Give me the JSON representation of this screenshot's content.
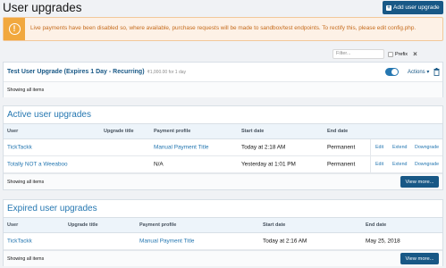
{
  "header": {
    "title": "User upgrades",
    "add_button": "Add user upgrade"
  },
  "notice": {
    "message": "Live payments have been disabled so, where available, purchase requests will be made to sandbox/test endpoints. To rectify this, please edit config.php."
  },
  "filter": {
    "placeholder": "Filter...",
    "prefix_label": "Prefix",
    "clear": "×"
  },
  "test_upgrade": {
    "title": "Test User Upgrade (Expires 1 Day - Recurring)",
    "price": "₹1,000.00 for 1 day",
    "toggle_on": true,
    "actions_label": "Actions ▾",
    "footer": "Showing all items"
  },
  "active": {
    "title": "Active user upgrades",
    "columns": {
      "user": "User",
      "upgrade": "Upgrade title",
      "payment": "Payment profile",
      "start": "Start date",
      "end": "End date"
    },
    "rows": [
      {
        "user": "TickTackk",
        "upgrade": "",
        "payment": "Manual Payment Title",
        "start": "Today at 2:18 AM",
        "end": "Permanent",
        "edit": "Edit",
        "extend": "Extend",
        "downgrade": "Downgrade"
      },
      {
        "user": "Totally NOT a Weeaboo",
        "upgrade": "",
        "payment": "N/A",
        "start": "Yesterday at 1:01 PM",
        "end": "Permanent",
        "edit": "Edit",
        "extend": "Extend",
        "downgrade": "Downgrade"
      }
    ],
    "footer": "Showing all items",
    "view_more": "View more..."
  },
  "expired": {
    "title": "Expired user upgrades",
    "columns": {
      "user": "User",
      "upgrade": "Upgrade title",
      "payment": "Payment profile",
      "start": "Start date",
      "end": "End date"
    },
    "rows": [
      {
        "user": "TickTackk",
        "upgrade": "",
        "payment": "Manual Payment Title",
        "start": "Today at 2:16 AM",
        "end": "May 25, 2018"
      }
    ],
    "footer": "Showing all items",
    "view_more": "View more..."
  },
  "colors": {
    "accent": "#185886",
    "link": "#2577b1",
    "warning": "#f1a83e"
  }
}
